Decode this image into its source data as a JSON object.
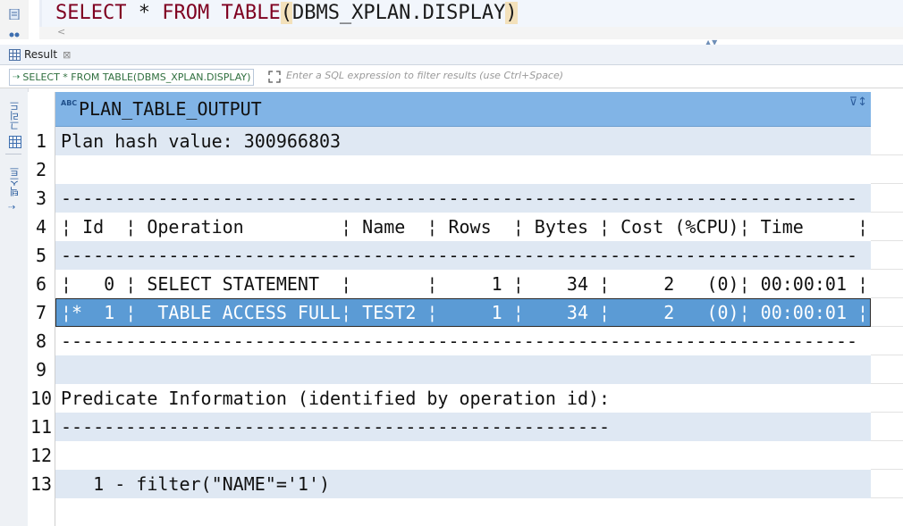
{
  "editor": {
    "sql_keyword1": "SELECT",
    "sql_star": " * ",
    "sql_keyword2": "FROM",
    "sql_space": " ",
    "sql_keyword3": "TABLE",
    "sql_paren_open": "(",
    "sql_args": "DBMS_XPLAN.DISPLAY",
    "sql_paren_close": ")",
    "scroll_left_glyph": "<"
  },
  "result_tab": {
    "label": "Result",
    "close_glyph": "⊠"
  },
  "filter": {
    "sql_chip": "SELECT * FROM TABLE(DBMS_XPLAN.DISPLAY)",
    "placeholder": "Enter a SQL expression to filter results (use Ctrl+Space)"
  },
  "side_panel": {
    "grid_tab": "그리드",
    "text_tab": "텍스트"
  },
  "grid": {
    "column_header": "PLAN_TABLE_OUTPUT",
    "abc_badge": "ABC",
    "rows": [
      {
        "num": "1",
        "text": "Plan hash value: 300966803"
      },
      {
        "num": "2",
        "text": ""
      },
      {
        "num": "3",
        "text": "--------------------------------------------------------------------------"
      },
      {
        "num": "4",
        "text": "¦ Id  ¦ Operation         ¦ Name  ¦ Rows  ¦ Bytes ¦ Cost (%CPU)¦ Time     ¦"
      },
      {
        "num": "5",
        "text": "--------------------------------------------------------------------------"
      },
      {
        "num": "6",
        "text": "¦   0 ¦ SELECT STATEMENT  ¦       ¦     1 ¦    34 ¦     2   (0)¦ 00:00:01 ¦"
      },
      {
        "num": "7",
        "text": "¦*  1 ¦  TABLE ACCESS FULL¦ TEST2 ¦     1 ¦    34 ¦     2   (0)¦ 00:00:01 ¦"
      },
      {
        "num": "8",
        "text": "--------------------------------------------------------------------------"
      },
      {
        "num": "9",
        "text": ""
      },
      {
        "num": "10",
        "text": "Predicate Information (identified by operation id):"
      },
      {
        "num": "11",
        "text": "---------------------------------------------------"
      },
      {
        "num": "12",
        "text": ""
      },
      {
        "num": "13",
        "text": "   1 - filter(\"NAME\"='1')"
      }
    ],
    "selected_row": "7"
  }
}
